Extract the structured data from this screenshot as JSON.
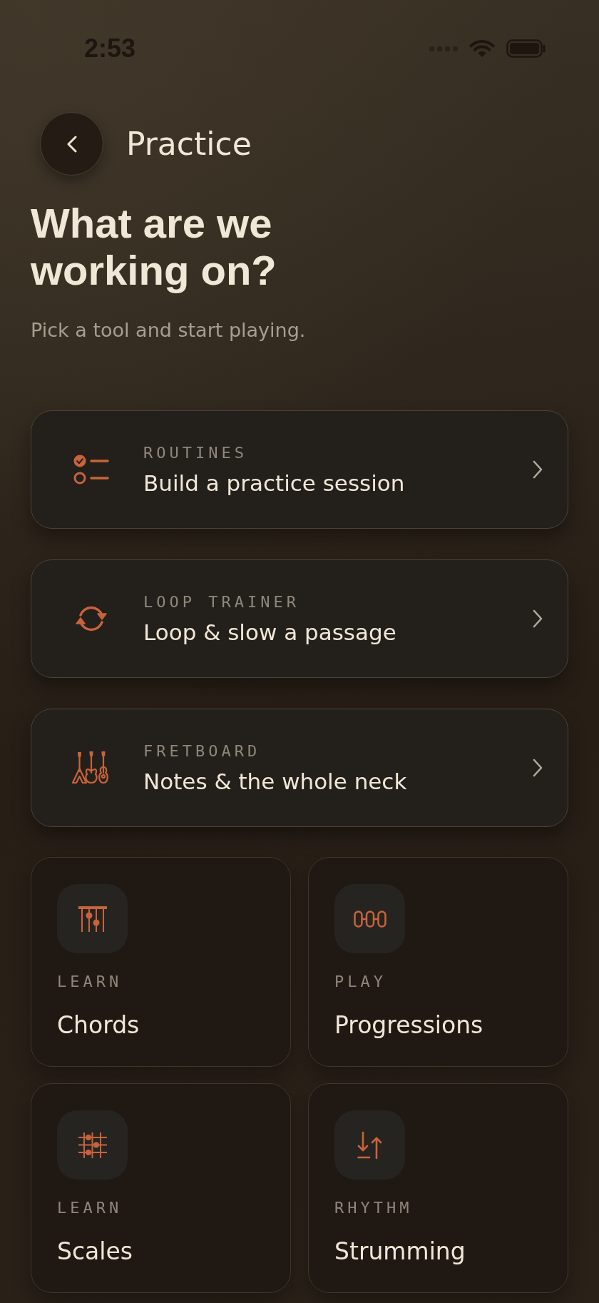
{
  "status_bar": {
    "time": "2:53"
  },
  "header": {
    "title": "Practice"
  },
  "intro": {
    "heading": "What are we working on?",
    "subtitle": "Pick a tool and start playing."
  },
  "tools": [
    {
      "label": "ROUTINES",
      "title": "Build a practice session"
    },
    {
      "label": "LOOP TRAINER",
      "title": "Loop & slow a passage"
    },
    {
      "label": "FRETBOARD",
      "title": "Notes & the whole neck"
    }
  ],
  "tiles": [
    {
      "label": "LEARN",
      "title": "Chords"
    },
    {
      "label": "PLAY",
      "title": "Progressions"
    },
    {
      "label": "LEARN",
      "title": "Scales"
    },
    {
      "label": "RHYTHM",
      "title": "Strumming"
    }
  ]
}
